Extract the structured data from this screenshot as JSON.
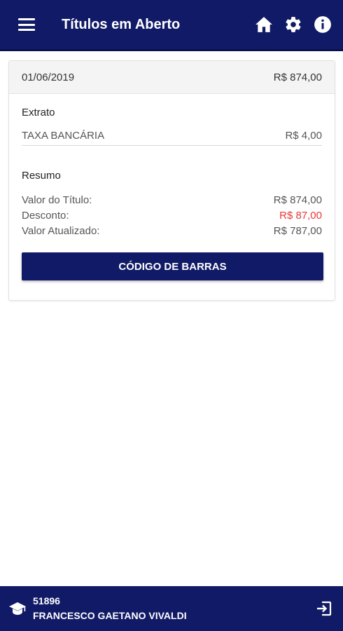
{
  "appbar": {
    "title": "Títulos em Aberto",
    "icons": [
      "menu-icon",
      "home-icon",
      "gear-icon",
      "info-icon"
    ],
    "background": "#111a66"
  },
  "titulo": {
    "date": "01/06/2019",
    "amount": "R$ 874,00"
  },
  "extrato": {
    "title": "Extrato",
    "items": [
      {
        "label": "TAXA BANCÁRIA",
        "value": "R$ 4,00"
      }
    ]
  },
  "resumo": {
    "title": "Resumo",
    "valor_titulo": {
      "label": "Valor do Título:",
      "value": "R$ 874,00"
    },
    "desconto": {
      "label": "Desconto:",
      "value": "R$ 87,00",
      "color": "#e53935"
    },
    "valor_atualizado": {
      "label": "Valor Atualizado:",
      "value": "R$ 787,00"
    }
  },
  "barcode_button": {
    "label": "CÓDIGO DE BARRAS"
  },
  "footer": {
    "code": "51896",
    "name": "FRANCESCO GAETANO VIVALDI",
    "icons": [
      "graduation-cap-icon",
      "logout-icon"
    ]
  }
}
